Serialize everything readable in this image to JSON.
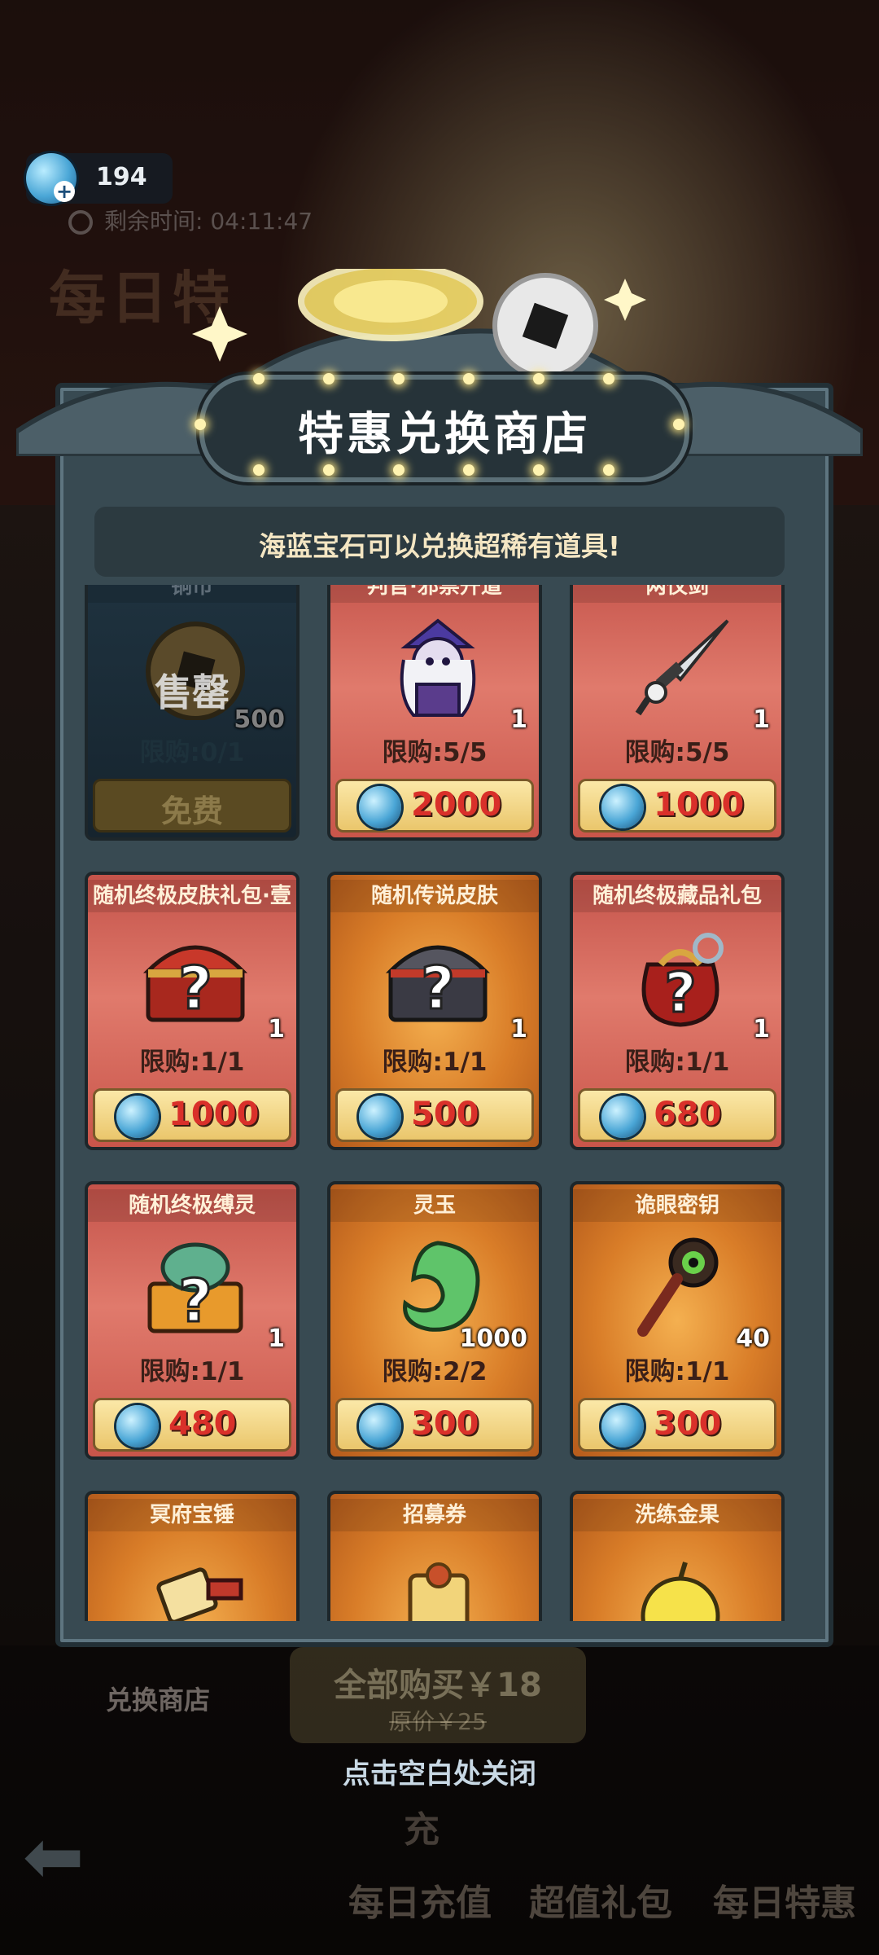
{
  "hud": {
    "gem_count": "194",
    "timer": "剩余时间: 04:11:47",
    "bg_title": "每日特"
  },
  "dialog": {
    "title": "特惠兑换商店",
    "subtitle": "海蓝宝石可以兑换超稀有道具!",
    "sold_out_label": "售罄"
  },
  "items": [
    {
      "name": "铜币",
      "qty": "500",
      "limit": "限购:0/1",
      "price": "免费",
      "style": "blue",
      "icon": "copper-coin-icon",
      "sold_out": true
    },
    {
      "name": "判官·邪祟开道",
      "qty": "1",
      "limit": "限购:5/5",
      "price": "2000",
      "style": "red",
      "icon": "judge-character-icon"
    },
    {
      "name": "两仪剑",
      "qty": "1",
      "limit": "限购:5/5",
      "price": "1000",
      "style": "red",
      "icon": "sword-icon"
    },
    {
      "name": "随机终极皮肤礼包·壹",
      "qty": "1",
      "limit": "限购:1/1",
      "price": "1000",
      "style": "red",
      "icon": "mystery-chest-icon"
    },
    {
      "name": "随机传说皮肤",
      "qty": "1",
      "limit": "限购:1/1",
      "price": "500",
      "style": "orange",
      "icon": "mystery-chest-dark-icon"
    },
    {
      "name": "随机终极藏品礼包",
      "qty": "1",
      "limit": "限购:1/1",
      "price": "680",
      "style": "red",
      "icon": "mystery-bag-icon"
    },
    {
      "name": "随机终极缚灵",
      "qty": "1",
      "limit": "限购:1/1",
      "price": "480",
      "style": "red",
      "icon": "mystery-spirit-chest-icon"
    },
    {
      "name": "灵玉",
      "qty": "1000",
      "limit": "限购:2/2",
      "price": "300",
      "style": "orange",
      "icon": "jade-icon"
    },
    {
      "name": "诡眼密钥",
      "qty": "40",
      "limit": "限购:1/1",
      "price": "300",
      "style": "orange",
      "icon": "eye-key-icon"
    },
    {
      "name": "冥府宝锤",
      "qty": "",
      "limit": "",
      "price": "",
      "style": "orange",
      "icon": "hammer-icon"
    },
    {
      "name": "招募券",
      "qty": "",
      "limit": "",
      "price": "",
      "style": "orange",
      "icon": "recruit-ticket-icon"
    },
    {
      "name": "洗练金果",
      "qty": "",
      "limit": "",
      "price": "",
      "style": "orange",
      "icon": "golden-apple-icon"
    }
  ],
  "bottom": {
    "bundle_label": "全部购买￥18",
    "bundle_original": "原价￥25",
    "exchange_shop": "兑换商店",
    "close_hint": "点击空白处关闭",
    "nav": [
      "每日充值",
      "超值礼包",
      "每日特惠"
    ],
    "nav_recharge_badge": "充"
  }
}
